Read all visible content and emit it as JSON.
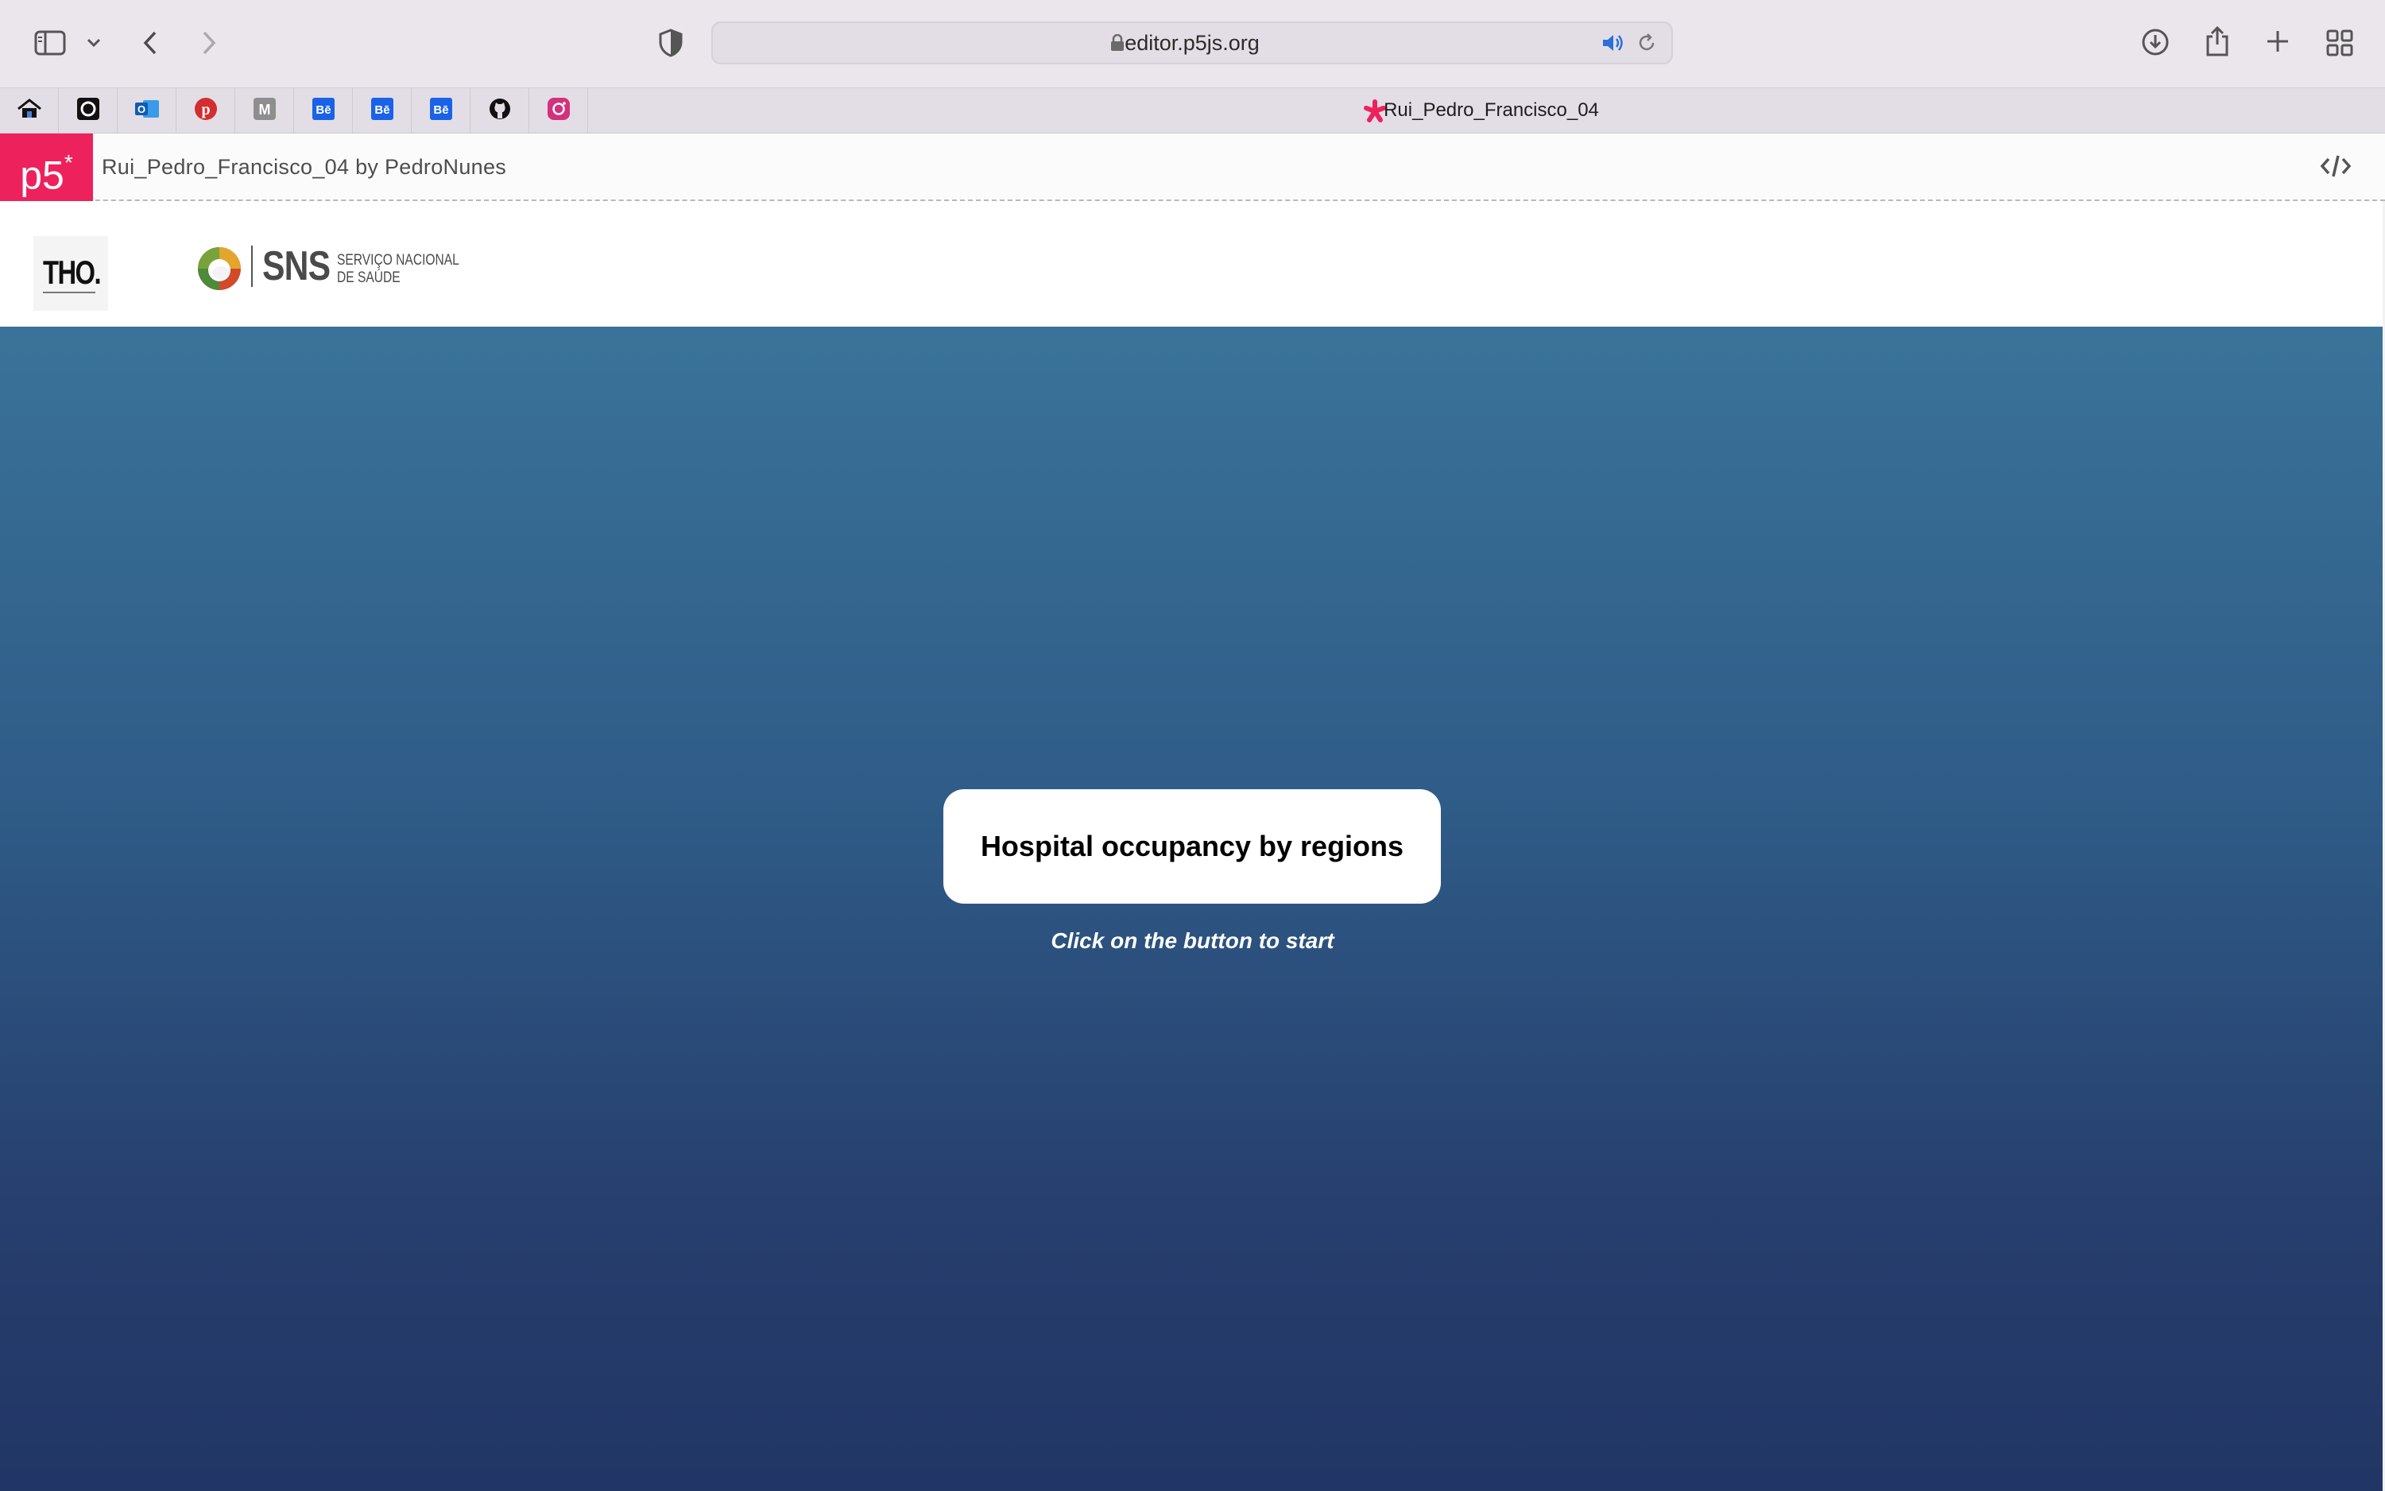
{
  "browser": {
    "url": "editor.p5js.org",
    "icons": {
      "sidebar": "sidebar-icon",
      "sidebar_menu": "chevron-down-icon",
      "back": "chevron-left-icon",
      "forward": "chevron-right-icon",
      "privacy": "shield-icon",
      "lock": "lock-icon",
      "audio": "speaker-icon",
      "reload": "reload-icon",
      "downloads": "download-icon",
      "share": "share-icon",
      "new_tab": "plus-icon",
      "tab_overview": "grid-icon"
    },
    "pinned_tabs": [
      {
        "name": "home",
        "icon": "home-icon"
      },
      {
        "name": "circle-app",
        "icon": "circle-app-icon"
      },
      {
        "name": "outlook",
        "icon": "outlook-icon"
      },
      {
        "name": "pinterest",
        "icon": "pinterest-icon"
      },
      {
        "name": "medium",
        "icon": "medium-icon",
        "letter": "M"
      },
      {
        "name": "behance-1",
        "icon": "behance-icon",
        "letter": "Bē"
      },
      {
        "name": "behance-2",
        "icon": "behance-icon",
        "letter": "Bē"
      },
      {
        "name": "behance-3",
        "icon": "behance-icon",
        "letter": "Bē"
      },
      {
        "name": "github",
        "icon": "github-icon"
      },
      {
        "name": "instagram",
        "icon": "instagram-icon"
      }
    ],
    "active_tab": {
      "title": "Rui_Pedro_Francisco_04",
      "icon": "p5-asterisk-icon"
    }
  },
  "p5_header": {
    "logo_text": "p5",
    "logo_sup": "*",
    "sketch_title": "Rui_Pedro_Francisco_04 by PedroNunes",
    "code_icon": "code-icon"
  },
  "sketch": {
    "logos": {
      "tho": "THO.",
      "sns_word": "SNS",
      "sns_line1": "SERVIÇO NACIONAL",
      "sns_line2": "DE SAÚDE"
    },
    "start_button_label": "Hospital occupancy by regions",
    "hint": "Click on the button to start"
  },
  "colors": {
    "p5_brand": "#ed225d",
    "gradient_top": "#3a7399",
    "gradient_bottom": "#213665",
    "button_bg": "#ffffff"
  }
}
